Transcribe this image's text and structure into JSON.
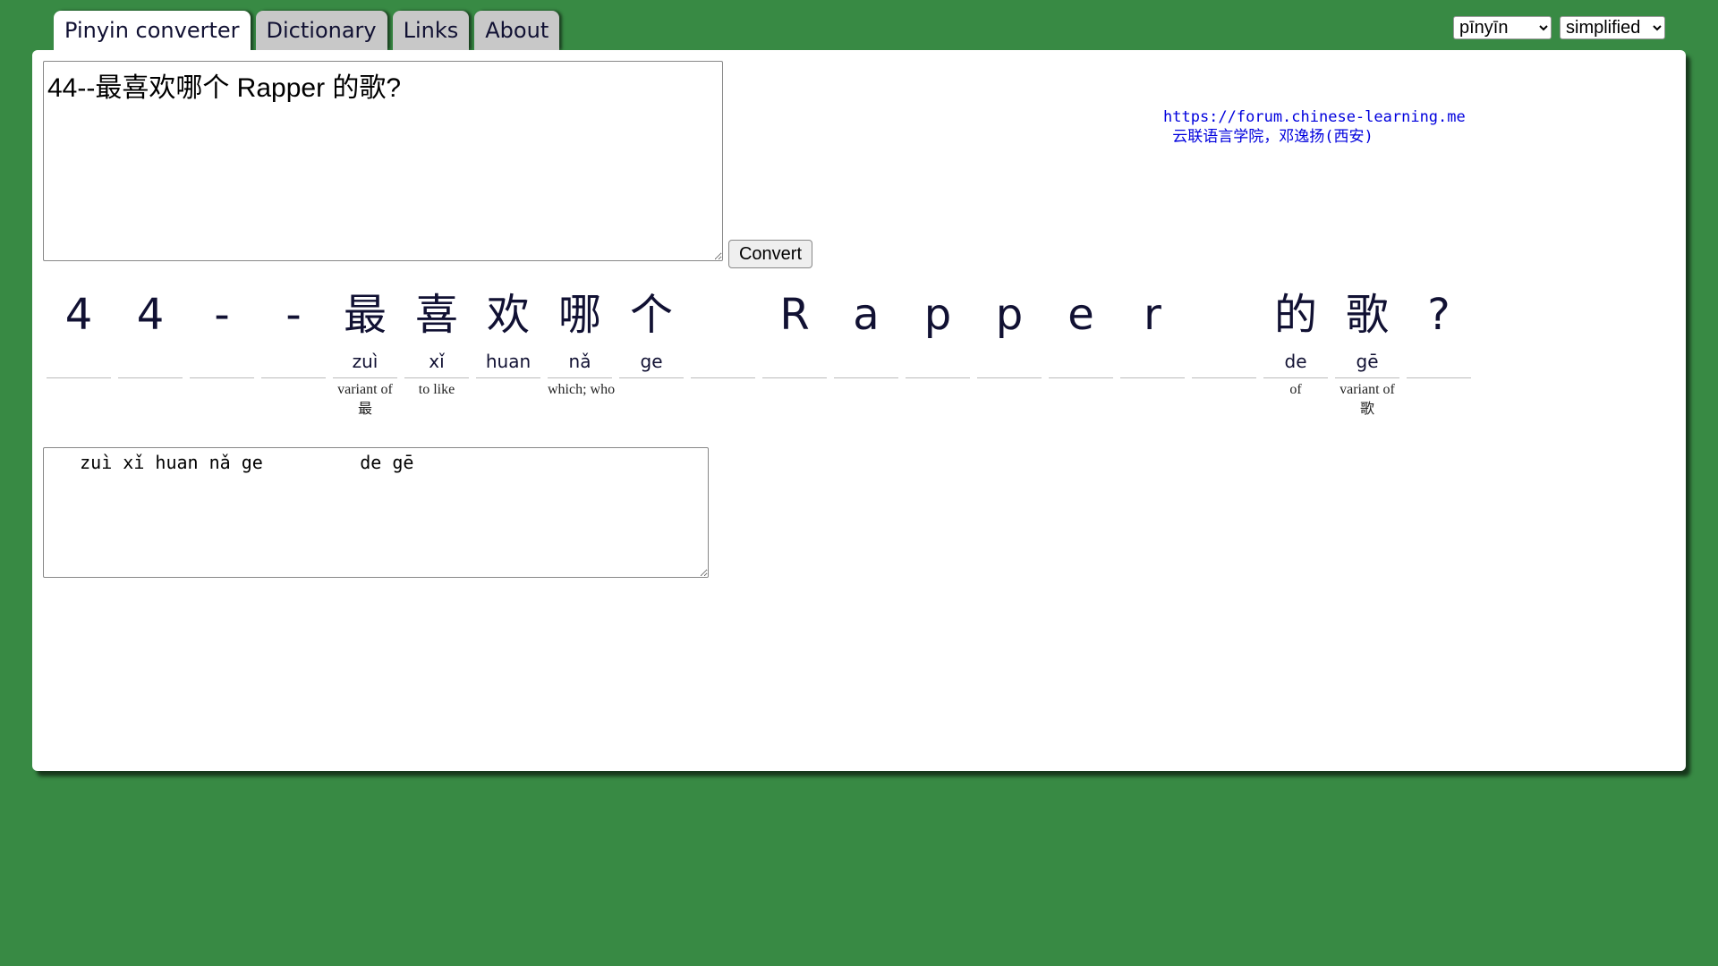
{
  "tabs": [
    {
      "label": "Pinyin converter",
      "active": true
    },
    {
      "label": "Dictionary",
      "active": false
    },
    {
      "label": "Links",
      "active": false
    },
    {
      "label": "About",
      "active": false
    }
  ],
  "selects": {
    "tone": {
      "value": "pīnyīn",
      "options": [
        "pīnyīn"
      ]
    },
    "script": {
      "value": "simplified",
      "options": [
        "simplified"
      ]
    }
  },
  "input": {
    "value": "44--最喜欢哪个 Rapper 的歌?"
  },
  "convert_label": "Convert",
  "credits": {
    "line1": "https://forum.chinese-learning.me",
    "line2": " 云联语言学院，邓逸扬(西安)"
  },
  "conversion": [
    {
      "char": "4",
      "pinyin": "",
      "gloss": ""
    },
    {
      "char": "4",
      "pinyin": "",
      "gloss": ""
    },
    {
      "char": "-",
      "pinyin": "",
      "gloss": ""
    },
    {
      "char": "-",
      "pinyin": "",
      "gloss": ""
    },
    {
      "char": "最",
      "pinyin": "zuì",
      "gloss": "variant of 最"
    },
    {
      "char": "喜",
      "pinyin": "xǐ",
      "gloss": "to like"
    },
    {
      "char": "欢",
      "pinyin": "huan",
      "gloss": ""
    },
    {
      "char": "哪",
      "pinyin": "nǎ",
      "gloss": "which; who"
    },
    {
      "char": "个",
      "pinyin": "ge",
      "gloss": ""
    },
    {
      "char": " ",
      "pinyin": "",
      "gloss": ""
    },
    {
      "char": "R",
      "pinyin": "",
      "gloss": ""
    },
    {
      "char": "a",
      "pinyin": "",
      "gloss": ""
    },
    {
      "char": "p",
      "pinyin": "",
      "gloss": ""
    },
    {
      "char": "p",
      "pinyin": "",
      "gloss": ""
    },
    {
      "char": "e",
      "pinyin": "",
      "gloss": ""
    },
    {
      "char": "r",
      "pinyin": "",
      "gloss": ""
    },
    {
      "char": " ",
      "pinyin": "",
      "gloss": ""
    },
    {
      "char": "的",
      "pinyin": "de",
      "gloss": "of"
    },
    {
      "char": "歌",
      "pinyin": "gē",
      "gloss": "variant of 歌"
    },
    {
      "char": "?",
      "pinyin": "",
      "gloss": ""
    }
  ],
  "output": {
    "value": "   zuì xǐ huan nǎ ge         de gē"
  }
}
